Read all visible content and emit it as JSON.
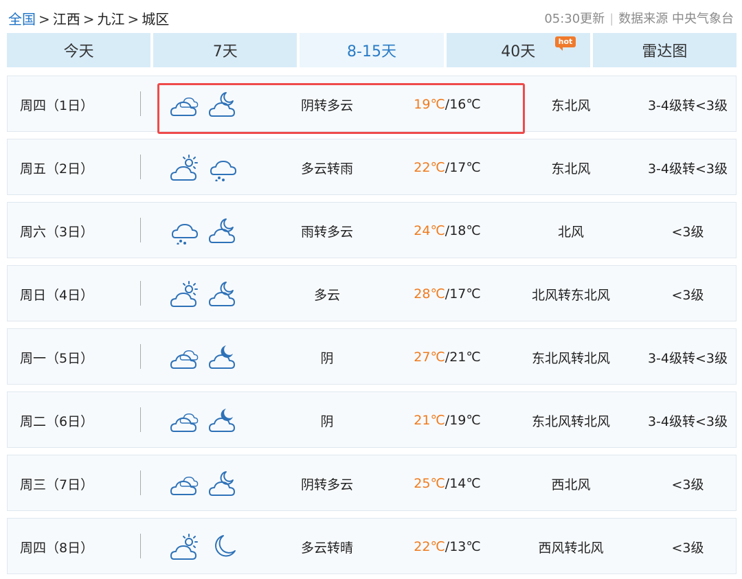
{
  "breadcrumb": {
    "root": "全国",
    "province": "江西",
    "city": "九江",
    "district": "城区",
    "sep": ">"
  },
  "meta": {
    "update_time": "05:30更新",
    "source": "数据来源 中央气象台"
  },
  "tabs": [
    {
      "label": "今天",
      "active": false
    },
    {
      "label": "7天",
      "active": false
    },
    {
      "label": "8-15天",
      "active": true
    },
    {
      "label": "40天",
      "active": false,
      "badge": "hot"
    },
    {
      "label": "雷达图",
      "active": false
    }
  ],
  "colors": {
    "accent": "#2a7bc6",
    "high_temp": "#f07a1c",
    "highlight_border": "#ef4a4a",
    "tab_bg": "#d8ecf8"
  },
  "forecast": [
    {
      "date": "周四（1日）",
      "day_icon": "overcast-icon",
      "night_icon": "partly-cloudy-night-icon",
      "desc": "阴转多云",
      "high": "19℃",
      "low": "/16℃",
      "wind": "东北风",
      "level": "3-4级转<3级",
      "highlighted": true
    },
    {
      "date": "周五（2日）",
      "day_icon": "partly-cloudy-day-icon",
      "night_icon": "rain-icon",
      "desc": "多云转雨",
      "high": "22℃",
      "low": "/17℃",
      "wind": "东北风",
      "level": "3-4级转<3级"
    },
    {
      "date": "周六（3日）",
      "day_icon": "rain-icon",
      "night_icon": "partly-cloudy-night-icon",
      "desc": "雨转多云",
      "high": "24℃",
      "low": "/18℃",
      "wind": "北风",
      "level": "<3级"
    },
    {
      "date": "周日（4日）",
      "day_icon": "partly-cloudy-day-icon",
      "night_icon": "partly-cloudy-night-icon",
      "desc": "多云",
      "high": "28℃",
      "low": "/17℃",
      "wind": "北风转东北风",
      "level": "<3级"
    },
    {
      "date": "周一（5日）",
      "day_icon": "overcast-icon",
      "night_icon": "overcast-night-icon",
      "desc": "阴",
      "high": "27℃",
      "low": "/21℃",
      "wind": "东北风转北风",
      "level": "3-4级转<3级"
    },
    {
      "date": "周二（6日）",
      "day_icon": "overcast-icon",
      "night_icon": "overcast-night-icon",
      "desc": "阴",
      "high": "21℃",
      "low": "/19℃",
      "wind": "东北风转北风",
      "level": "3-4级转<3级"
    },
    {
      "date": "周三（7日）",
      "day_icon": "overcast-icon",
      "night_icon": "partly-cloudy-night-icon",
      "desc": "阴转多云",
      "high": "25℃",
      "low": "/14℃",
      "wind": "西北风",
      "level": "<3级"
    },
    {
      "date": "周四（8日）",
      "day_icon": "partly-cloudy-day-icon",
      "night_icon": "clear-night-icon",
      "desc": "多云转晴",
      "high": "22℃",
      "low": "/13℃",
      "wind": "西风转北风",
      "level": "<3级"
    }
  ]
}
